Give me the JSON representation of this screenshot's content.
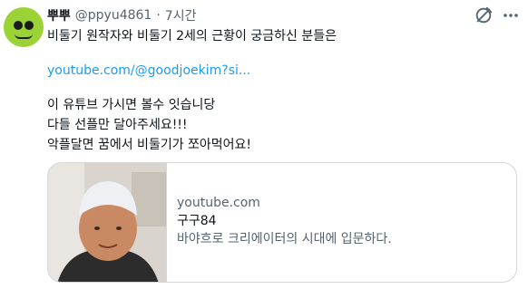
{
  "tweet": {
    "display_name": "뿌뿌",
    "handle": "@ppyu4861",
    "separator": "·",
    "time": "7시간",
    "lines": [
      "비둘기 원작자와 비둘기 2세의 근황이 궁금하신 분들은",
      "youtube.com/@goodjoekim?si...",
      "이 유튜브 가시면 볼수 잇습니당",
      "다들 선플만 달아주세요!!!",
      "악플달면 꿈에서 비둘기가 쪼아먹어요!"
    ],
    "link_color": "#1d9bf0"
  },
  "card": {
    "domain": "youtube.com",
    "title": "구구84",
    "description": "바야흐로 크리에이터의 시대에 입문하다."
  },
  "icons": {
    "avatar": "frog-avatar",
    "grok": "grok-icon",
    "more": "more-icon"
  }
}
